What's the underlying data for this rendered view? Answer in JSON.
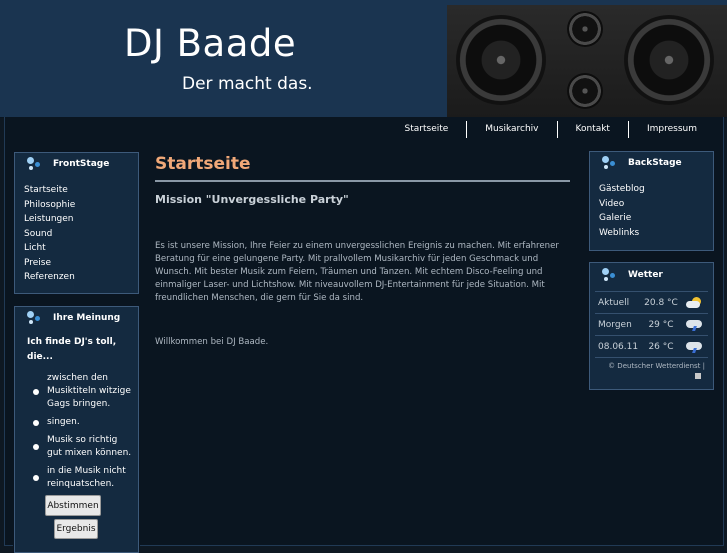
{
  "header": {
    "title": "DJ Baade",
    "subtitle": "Der macht das."
  },
  "nav": {
    "items": [
      "Startseite",
      "Musikarchiv",
      "Kontakt",
      "Impressum"
    ]
  },
  "frontstage": {
    "title": "FrontStage",
    "items": [
      "Startseite",
      "Philosophie",
      "Leistungen",
      "Sound",
      "Licht",
      "Preise",
      "Referenzen"
    ]
  },
  "poll": {
    "title": "Ihre Meinung",
    "question": "Ich finde DJ's toll, die...",
    "options": [
      "zwischen den Musiktiteln witzige Gags bringen.",
      "singen.",
      "Musik so richtig gut mixen können.",
      "in die Musik nicht reinquatschen."
    ],
    "vote_label": "Abstimmen",
    "result_label": "Ergebnis"
  },
  "content": {
    "title": "Startseite",
    "mission": "Mission \"Unvergessliche Party\"",
    "paragraph": "Es ist unsere Mission, Ihre Feier zu einem unvergesslichen Ereignis zu machen. Mit erfahrener Beratung für eine gelungene Party. Mit prallvollem Musikarchiv für jeden Geschmack und Wunsch. Mit bester Musik zum Feiern, Träumen und Tanzen. Mit echtem Disco-Feeling und einmaliger Laser- und Lichtshow. Mit niveauvollem DJ-Entertainment für jede Situation. Mit freundlichen Menschen, die gern für Sie da sind.",
    "welcome": "Willkommen bei DJ Baade."
  },
  "backstage": {
    "title": "BackStage",
    "items": [
      "Gästeblog",
      "Video",
      "Galerie",
      "Weblinks"
    ]
  },
  "weather": {
    "title": "Wetter",
    "rows": [
      {
        "label": "Aktuell",
        "temp": "20.8 °C",
        "icon": "partly-cloudy-sun-icon"
      },
      {
        "label": "Morgen",
        "temp": "29 °C",
        "icon": "thunderstorm-icon"
      },
      {
        "label": "08.06.11",
        "temp": "26 °C",
        "icon": "thunderstorm-icon"
      }
    ],
    "credit": "© Deutscher Wetterdienst |"
  },
  "colors": {
    "header_bg": "#1a3450",
    "page_bg": "#0a1520",
    "box_bg": "#142a40",
    "content_title": "#f0a878"
  }
}
